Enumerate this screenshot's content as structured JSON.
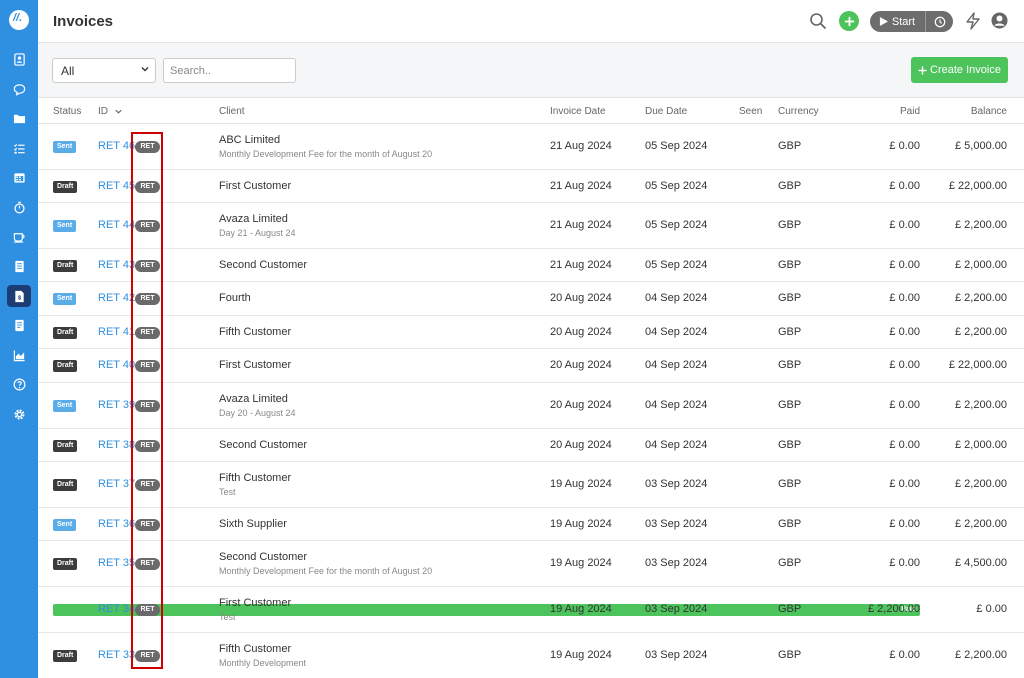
{
  "app": {
    "logo_text": "//.",
    "accent": "#2f8fe0"
  },
  "sidebar": {
    "items": [
      {
        "icon": "contacts-icon"
      },
      {
        "icon": "chat-icon"
      },
      {
        "icon": "folder-icon"
      },
      {
        "icon": "tasks-icon"
      },
      {
        "icon": "calendar-icon"
      },
      {
        "icon": "stopwatch-icon"
      },
      {
        "icon": "coffee-icon"
      },
      {
        "icon": "estimate-icon"
      },
      {
        "icon": "invoice-icon",
        "active": true
      },
      {
        "icon": "document-icon"
      },
      {
        "icon": "reports-icon"
      },
      {
        "icon": "help-icon"
      },
      {
        "icon": "settings-icon"
      }
    ]
  },
  "header": {
    "title": "Invoices",
    "start_label": "Start"
  },
  "toolbar": {
    "filter_value": "All",
    "search_placeholder": "Search..",
    "create_label": "Create Invoice"
  },
  "table": {
    "columns": {
      "status": "Status",
      "id": "ID",
      "client": "Client",
      "invoice_date": "Invoice Date",
      "due_date": "Due Date",
      "seen": "Seen",
      "currency": "Currency",
      "paid": "Paid",
      "balance": "Balance"
    },
    "rows": [
      {
        "status": "Sent",
        "id": "RET 46",
        "tag": "RET",
        "client": "ABC Limited",
        "desc": "Monthly Development Fee for the month of August 20",
        "invoice_date": "21 Aug 2024",
        "due_date": "05 Sep 2024",
        "currency": "GBP",
        "paid": "£ 0.00",
        "balance": "£ 5,000.00"
      },
      {
        "status": "Draft",
        "id": "RET 45",
        "tag": "RET",
        "client": "First Customer",
        "desc": "",
        "invoice_date": "21 Aug 2024",
        "due_date": "05 Sep 2024",
        "currency": "GBP",
        "paid": "£ 0.00",
        "balance": "£ 22,000.00"
      },
      {
        "status": "Sent",
        "id": "RET 44",
        "tag": "RET",
        "client": "Avaza Limited",
        "desc": "Day 21 - August 24",
        "invoice_date": "21 Aug 2024",
        "due_date": "05 Sep 2024",
        "currency": "GBP",
        "paid": "£ 0.00",
        "balance": "£ 2,200.00"
      },
      {
        "status": "Draft",
        "id": "RET 43",
        "tag": "RET",
        "client": "Second Customer",
        "desc": "",
        "invoice_date": "21 Aug 2024",
        "due_date": "05 Sep 2024",
        "currency": "GBP",
        "paid": "£ 0.00",
        "balance": "£ 2,000.00"
      },
      {
        "status": "Sent",
        "id": "RET 42",
        "tag": "RET",
        "client": "Fourth",
        "desc": "",
        "invoice_date": "20 Aug 2024",
        "due_date": "04 Sep 2024",
        "currency": "GBP",
        "paid": "£ 0.00",
        "balance": "£ 2,200.00"
      },
      {
        "status": "Draft",
        "id": "RET 41",
        "tag": "RET",
        "client": "Fifth Customer",
        "desc": "",
        "invoice_date": "20 Aug 2024",
        "due_date": "04 Sep 2024",
        "currency": "GBP",
        "paid": "£ 0.00",
        "balance": "£ 2,200.00"
      },
      {
        "status": "Draft",
        "id": "RET 40",
        "tag": "RET",
        "client": "First Customer",
        "desc": "",
        "invoice_date": "20 Aug 2024",
        "due_date": "04 Sep 2024",
        "currency": "GBP",
        "paid": "£ 0.00",
        "balance": "£ 22,000.00"
      },
      {
        "status": "Sent",
        "id": "RET 39",
        "tag": "RET",
        "client": "Avaza Limited",
        "desc": "Day 20 - August 24",
        "invoice_date": "20 Aug 2024",
        "due_date": "04 Sep 2024",
        "currency": "GBP",
        "paid": "£ 0.00",
        "balance": "£ 2,200.00"
      },
      {
        "status": "Draft",
        "id": "RET 38",
        "tag": "RET",
        "client": "Second Customer",
        "desc": "",
        "invoice_date": "20 Aug 2024",
        "due_date": "04 Sep 2024",
        "currency": "GBP",
        "paid": "£ 0.00",
        "balance": "£ 2,000.00"
      },
      {
        "status": "Draft",
        "id": "RET 37",
        "tag": "RET",
        "client": "Fifth Customer",
        "desc": "Test",
        "invoice_date": "19 Aug 2024",
        "due_date": "03 Sep 2024",
        "currency": "GBP",
        "paid": "£ 0.00",
        "balance": "£ 2,200.00"
      },
      {
        "status": "Sent",
        "id": "RET 36",
        "tag": "RET",
        "client": "Sixth Supplier",
        "desc": "",
        "invoice_date": "19 Aug 2024",
        "due_date": "03 Sep 2024",
        "currency": "GBP",
        "paid": "£ 0.00",
        "balance": "£ 2,200.00"
      },
      {
        "status": "Draft",
        "id": "RET 35",
        "tag": "RET",
        "client": "Second Customer",
        "desc": "Monthly Development Fee for the month of August 20",
        "invoice_date": "19 Aug 2024",
        "due_date": "03 Sep 2024",
        "currency": "GBP",
        "paid": "£ 0.00",
        "balance": "£ 4,500.00"
      },
      {
        "status": "Paid",
        "id": "RET 34",
        "tag": "RET",
        "client": "First Customer",
        "desc": "Test",
        "invoice_date": "19 Aug 2024",
        "due_date": "03 Sep 2024",
        "currency": "GBP",
        "paid": "£ 2,200.00",
        "balance": "£ 0.00"
      },
      {
        "status": "Draft",
        "id": "RET 33",
        "tag": "RET",
        "client": "Fifth Customer",
        "desc": "Monthly Development",
        "invoice_date": "19 Aug 2024",
        "due_date": "03 Sep 2024",
        "currency": "GBP",
        "paid": "£ 0.00",
        "balance": "£ 2,200.00"
      }
    ]
  }
}
